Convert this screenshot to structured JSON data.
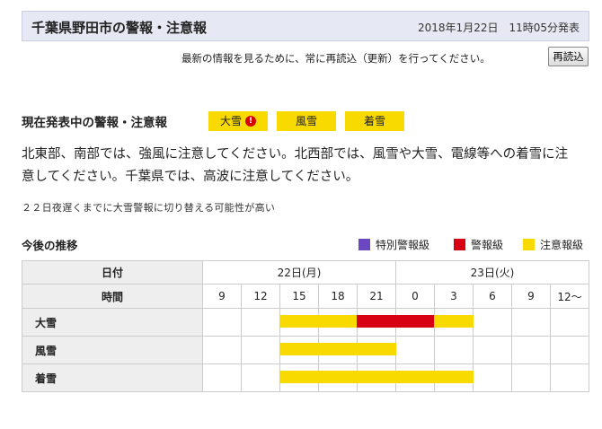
{
  "header": {
    "title": "千葉県野田市の警報・注意報",
    "timestamp": "2018年1月22日　11時05分発表"
  },
  "refresh": {
    "note": "最新の情報を見るために、常に再読込（更新）を行ってください。",
    "button_label": "再読込"
  },
  "current": {
    "title": "現在発表中の警報・注意報",
    "badges": [
      {
        "label": "大雪",
        "icon": "!",
        "icon_name": "warning-icon"
      },
      {
        "label": "風雪"
      },
      {
        "label": "着雪"
      }
    ],
    "description": "北東部、南部では、強風に注意してください。北西部では、風雪や大雪、電線等への着雪に注意してください。千葉県では、高波に注意してください。",
    "note": "２２日夜遅くまでに大雪警報に切り替える可能性が高い"
  },
  "trend": {
    "title": "今後の推移",
    "legend": [
      {
        "label": "特別警報級",
        "color": "#6b47c2"
      },
      {
        "label": "警報級",
        "color": "#d80013"
      },
      {
        "label": "注意報級",
        "color": "#f8d900"
      }
    ],
    "date_header": "日付",
    "time_header": "時間",
    "dates": [
      "22日(月)",
      "23日(火)"
    ],
    "times": [
      "9",
      "12",
      "15",
      "18",
      "21",
      "0",
      "3",
      "6",
      "9",
      "12～"
    ],
    "rows": [
      {
        "label": "大雪",
        "levels": [
          "none",
          "none",
          "advisory",
          "advisory",
          "warning",
          "warning",
          "advisory",
          "none",
          "none",
          "none"
        ]
      },
      {
        "label": "風雪",
        "levels": [
          "none",
          "none",
          "advisory",
          "advisory",
          "advisory",
          "none",
          "none",
          "none",
          "none",
          "none"
        ]
      },
      {
        "label": "着雪",
        "levels": [
          "none",
          "none",
          "advisory",
          "advisory",
          "advisory",
          "advisory",
          "advisory",
          "none",
          "none",
          "none"
        ]
      }
    ]
  }
}
